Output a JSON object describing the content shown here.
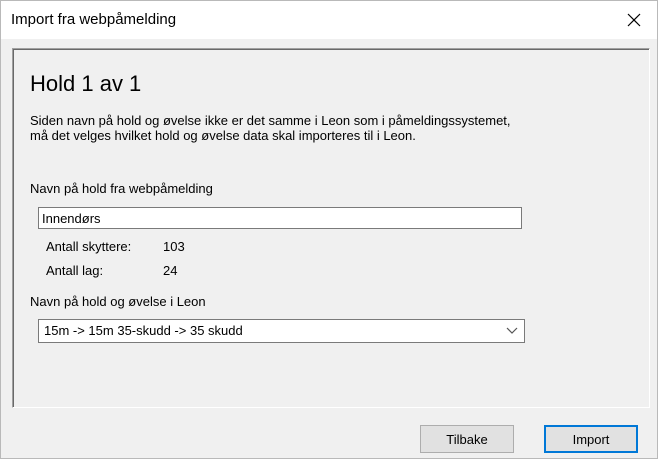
{
  "window": {
    "title": "Import fra webpåmelding",
    "close_icon": "close-icon"
  },
  "main": {
    "heading": "Hold 1 av 1",
    "description": "Siden navn på hold og øvelse ikke er det samme i Leon som i påmeldingssystemet, må det velges hvilket hold og øvelse data skal importeres til i Leon.",
    "web_team_label": "Navn på hold fra webpåmelding",
    "web_team_value": "Innendørs",
    "shooters_label": "Antall skyttere:",
    "shooters_value": "103",
    "teams_label": "Antall lag:",
    "teams_value": "24",
    "leon_label": "Navn på hold og øvelse i Leon",
    "leon_selected": "15m -> 15m 35-skudd -> 35 skudd"
  },
  "buttons": {
    "back_label": "Tilbake",
    "import_label": "Import"
  },
  "colors": {
    "accent": "#0078d7",
    "background": "#f0f0f0"
  }
}
